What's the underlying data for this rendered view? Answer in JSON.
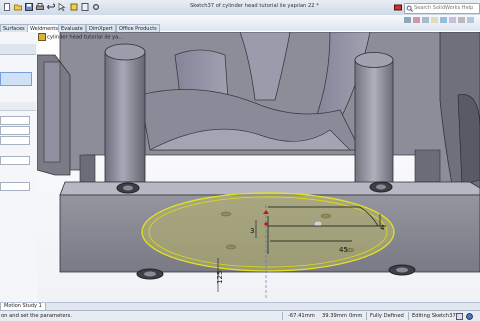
{
  "window": {
    "title": "Sketch37 of cylinder head tutorial ile yapılan 22 *",
    "search_placeholder": "Search SolidWorks Help"
  },
  "tabs": [
    "Surfaces",
    "Weldments",
    "Evaluate",
    "DimXpert",
    "Office Products"
  ],
  "tree": {
    "root_label": "cylinder head tutorial ile ya..."
  },
  "dimensions": {
    "d1": "4",
    "d2": "3",
    "d3": "45",
    "d4": "125"
  },
  "bottom_tabs": [
    "Motion Study 1"
  ],
  "status": {
    "prompt": "on and set the parameters.",
    "x": "-67.41mm",
    "y": "39.39mm",
    "z": "0mm",
    "state": "Fully Defined",
    "editing": "Editing Sketch37"
  },
  "colors": {
    "model_gray": "#8f8f9a",
    "model_dark": "#5d5d6a",
    "sketch_yellow": "#e6e61a",
    "dimension_line": "#111111",
    "titlebar": "#cfd9e6"
  }
}
